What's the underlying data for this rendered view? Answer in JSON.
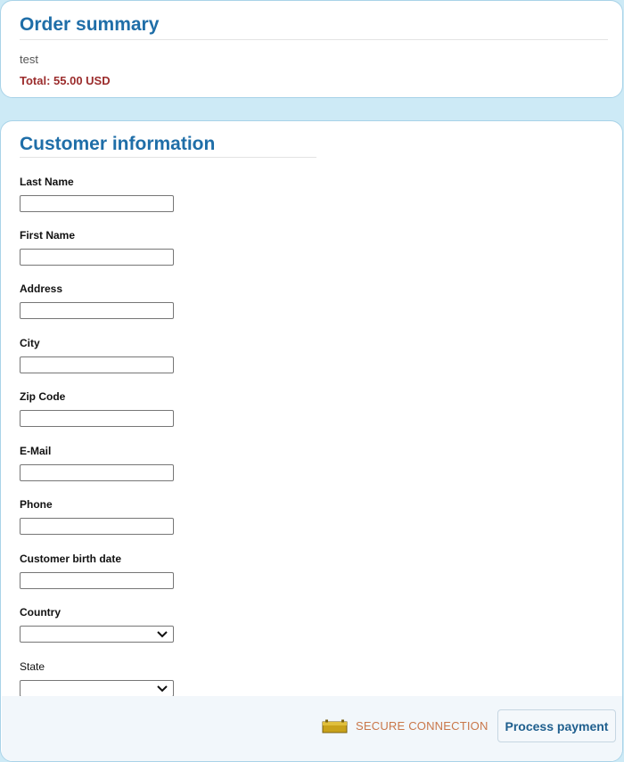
{
  "order_summary": {
    "heading": "Order summary",
    "item": "test",
    "total": "Total: 55.00 USD"
  },
  "customer_info": {
    "heading": "Customer information",
    "fields": [
      {
        "label": "Last Name",
        "type": "text",
        "value": ""
      },
      {
        "label": "First Name",
        "type": "text",
        "value": ""
      },
      {
        "label": "Address",
        "type": "text",
        "value": ""
      },
      {
        "label": "City",
        "type": "text",
        "value": ""
      },
      {
        "label": "Zip Code",
        "type": "text",
        "value": ""
      },
      {
        "label": "E-Mail",
        "type": "text",
        "value": ""
      },
      {
        "label": "Phone",
        "type": "text",
        "value": ""
      },
      {
        "label": "Customer birth date",
        "type": "text",
        "value": ""
      },
      {
        "label": "Country",
        "type": "select",
        "value": ""
      },
      {
        "label": "State",
        "type": "select",
        "value": ""
      }
    ]
  },
  "footer": {
    "secure_label": "SECURE CONNECTION",
    "process_button": "Process payment",
    "icon": "card-lock-icon"
  },
  "colors": {
    "page_background": "#cdeaf6",
    "heading": "#1f6ea8",
    "total": "#9b2c2c",
    "secure_text": "#c9774a"
  }
}
